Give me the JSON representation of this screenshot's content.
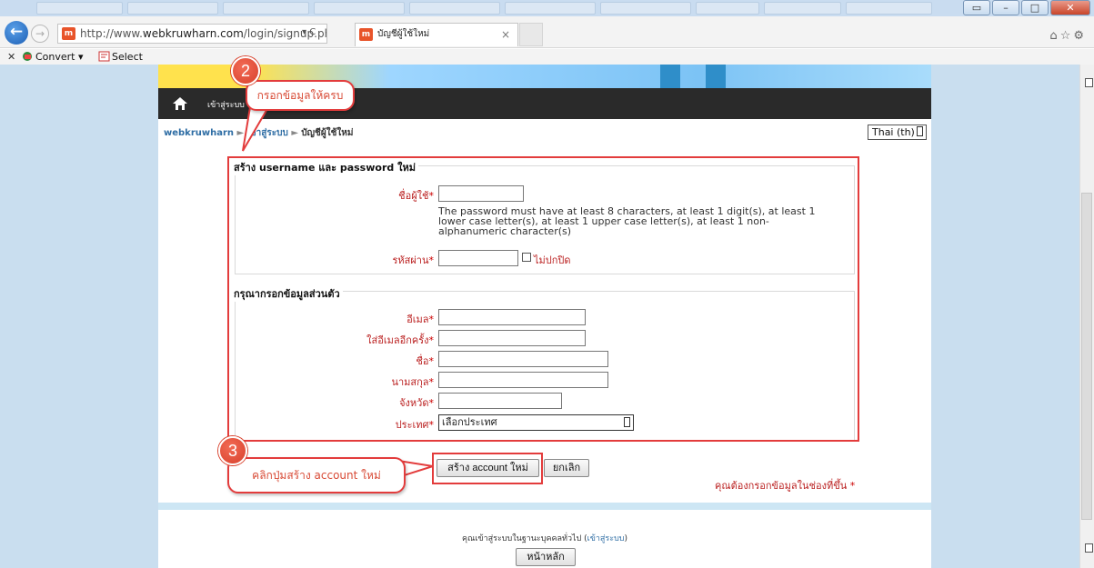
{
  "browser": {
    "url_prefix": "http://www.",
    "url_domain": "webkruwharn.com",
    "url_path": "/login/signup.php",
    "tab_title": "บัญชีผู้ใช้ใหม่",
    "favicon_text": "m",
    "refresh_glyph": "▾ C",
    "tab_close": "×",
    "toolbar": {
      "convert_label": "Convert",
      "select_label": "Select"
    }
  },
  "site": {
    "nav_login": "เข้าสู่ระบบ",
    "breadcrumb": [
      "webkruwharn",
      "เข้าสู่ระบบ",
      "บัญชีผู้ใช้ใหม่"
    ],
    "language": "Thai (th)"
  },
  "form": {
    "section1_legend": "สร้าง username และ password ใหม่",
    "username_label": "ชื่อผู้ใช้",
    "password_policy": "The password must have at least 8 characters, at least 1 digit(s), at least 1 lower case letter(s), at least 1 upper case letter(s), at least 1 non-alphanumeric character(s)",
    "password_label": "รหัสผ่าน",
    "unmask_label": "ไม่ปกปิด",
    "section2_legend": "กรุณากรอกข้อมูลส่วนตัว",
    "email_label": "อีเมล",
    "email_again_label": "ใส่อีเมลอีกครั้ง",
    "firstname_label": "ชื่อ",
    "lastname_label": "นามสกุล",
    "city_label": "จังหวัด",
    "country_label": "ประเทศ",
    "country_value": "เลือกประเทศ",
    "required_mark": "*",
    "submit_label": "สร้าง account ใหม่",
    "cancel_label": "ยกเลิก",
    "required_note": "คุณต้องกรอกข้อมูลในช่องที่ขึ้น"
  },
  "footer": {
    "guest_text": "คุณเข้าสู่ระบบในฐานะบุคคลทั่วไป (",
    "login_link": "เข้าสู่ระบบ",
    "guest_close": ")",
    "home_button": "หน้าหลัก"
  },
  "annotations": {
    "step2_number": "2",
    "step2_text": "กรอกข้อมูลให้ครบ",
    "step3_number": "3",
    "step3_text": "คลิกปุ่มสร้าง account ใหม่",
    "color": "#e33c3c"
  },
  "icons": {
    "back": "back-arrow-icon",
    "forward": "forward-arrow-icon",
    "home": "home-icon",
    "favorites": "star-icon",
    "settings": "gear-icon"
  }
}
